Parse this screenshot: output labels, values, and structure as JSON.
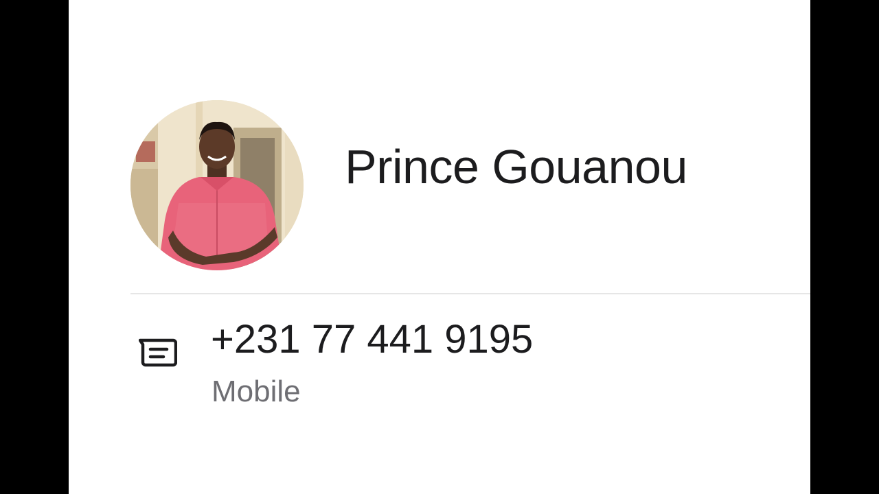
{
  "contact": {
    "name": "Prince Gouanou",
    "phone": {
      "number": "+231 77 441 9195",
      "type": "Mobile",
      "action_icon": "message-icon"
    }
  },
  "colors": {
    "page_background": "#ffffff",
    "side_bars": "#000000",
    "primary_text": "#1c1c1e",
    "secondary_text": "#6e6e73",
    "divider": "#e6e6e6",
    "shirt": "#e8637a"
  }
}
